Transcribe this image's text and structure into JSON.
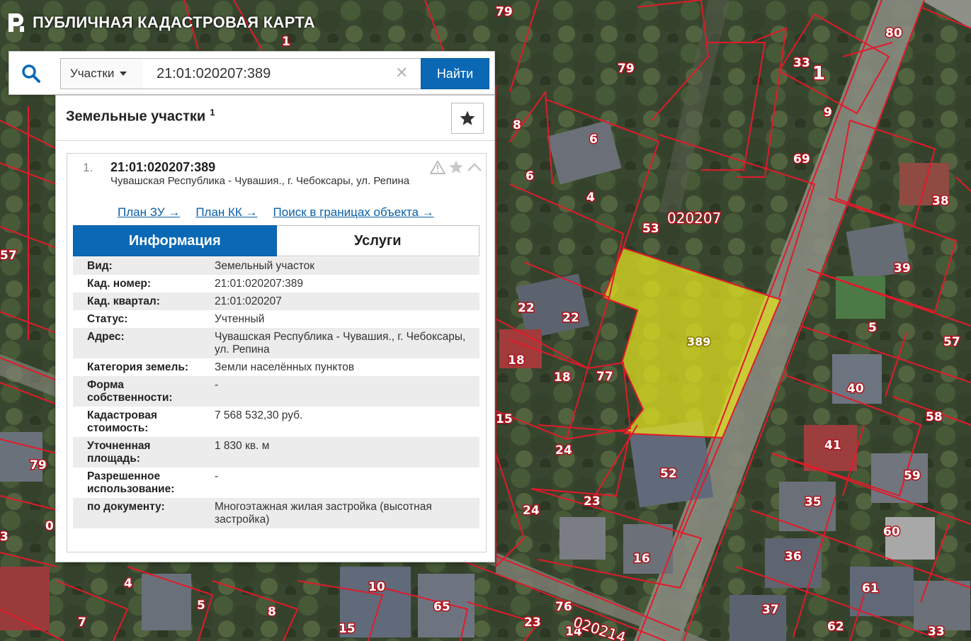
{
  "app": {
    "title": "ПУБЛИЧНАЯ КАДАСТРОВАЯ КАРТА"
  },
  "search": {
    "type_select": "Участки",
    "query": "21:01:020207:389",
    "button_label": "Найти",
    "clear_glyph": "✕"
  },
  "results": {
    "title": "Земельные участки",
    "count": "1",
    "item": {
      "index": "1.",
      "cadastral_number": "21:01:020207:389",
      "address": "Чувашская Республика - Чувашия., г. Чебоксары, ул. Репина",
      "links": {
        "plan_zu": "План ЗУ →",
        "plan_kk": "План КК →",
        "search_in_bounds": "Поиск в границах объекта →"
      },
      "tabs": {
        "info": "Информация",
        "services": "Услуги"
      },
      "details": [
        {
          "label": "Вид:",
          "value": "Земельный участок"
        },
        {
          "label": "Кад. номер:",
          "value": "21:01:020207:389"
        },
        {
          "label": "Кад. квартал:",
          "value": "21:01:020207"
        },
        {
          "label": "Статус:",
          "value": "Учтенный"
        },
        {
          "label": "Адрес:",
          "value": "Чувашская Республика - Чувашия., г. Чебоксары, ул. Репина"
        },
        {
          "label": "Категория земель:",
          "value": "Земли населённых пунктов"
        },
        {
          "label": "Форма собственности:",
          "value": "-"
        },
        {
          "label": "Кадастровая стоимость:",
          "value": "7 568 532,30 руб."
        },
        {
          "label": "Уточненная площадь:",
          "value": "1 830 кв. м"
        },
        {
          "label": "Разрешенное использование:",
          "value": "-"
        },
        {
          "label": "по документу:",
          "value": "Многоэтажная жилая застройка (высотная застройка)"
        }
      ]
    }
  },
  "map": {
    "block_labels": [
      "020207",
      "020214"
    ],
    "selected_parcel_label": "389",
    "parcel_labels": [
      "79",
      "80",
      "33",
      "1",
      "79",
      "8",
      "6",
      "69",
      "6",
      "4",
      "38",
      "53",
      "39",
      "57",
      "22",
      "22",
      "5",
      "18",
      "18",
      "77",
      "57",
      "40",
      "15",
      "58",
      "24",
      "41",
      "52",
      "59",
      "79",
      "23",
      "35",
      "24",
      "60",
      "16",
      "36",
      "4",
      "10",
      "5",
      "65",
      "8",
      "61",
      "7",
      "37",
      "15",
      "76",
      "62",
      "33",
      "3",
      "14",
      "23",
      "1",
      "9",
      "0"
    ],
    "colors": {
      "boundary": "#e21a2a",
      "selected_fill": "#e6e61e",
      "accent": "#0a68b5"
    }
  }
}
